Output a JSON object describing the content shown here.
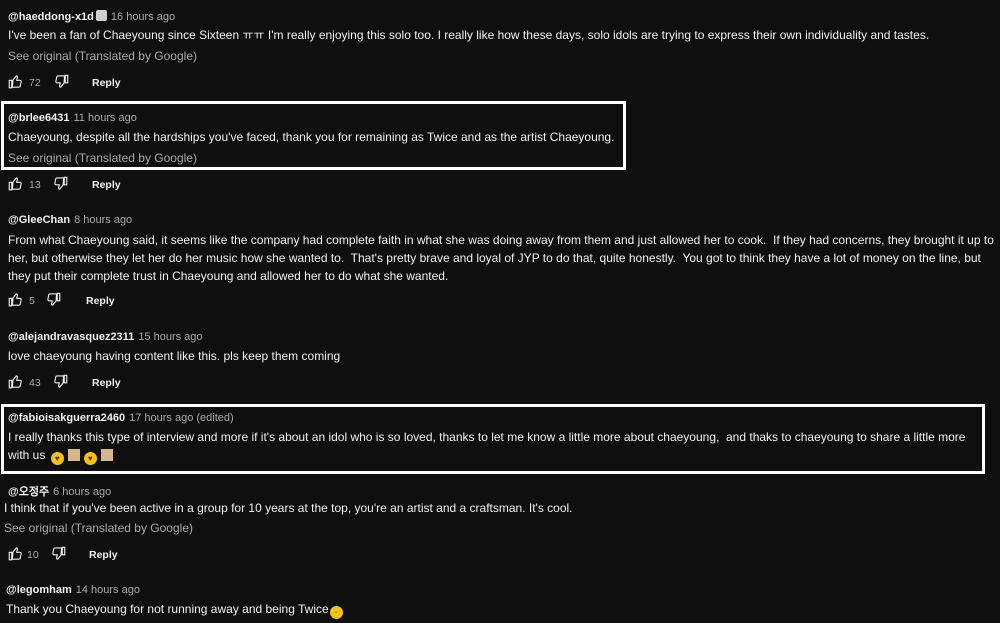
{
  "reply_label": "Reply",
  "see_original_label": "See original (Translated by Google)",
  "comments": [
    {
      "author": "@haeddong-x1d",
      "time": "16 hours ago",
      "text": "I've been a fan of Chaeyoung since Sixteen ㅠㅠ I'm really enjoying this solo too. I really like how these days, solo idols are trying to express their own individuality and tastes.",
      "likes": "72"
    },
    {
      "author": "@brlee6431",
      "time": "11 hours ago",
      "text": "Chaeyoung, despite all the hardships you've faced, thank you for remaining as Twice and as the artist Chaeyoung.",
      "likes": "13"
    },
    {
      "author": "@GleeChan",
      "time": "8 hours ago",
      "text": "From what Chaeyoung said, it seems like the company had complete faith in what she was doing away from them and just allowed her to cook.  If they had concerns, they brought it up to her, but otherwise they let her do her music how she wanted to.  That's pretty brave and loyal of JYP to do that, quite honestly.  You got to think they have a lot of money on the line, but they put their complete trust in Chaeyoung and allowed her to do what she wanted.",
      "likes": "5"
    },
    {
      "author": "@alejandravasquez2311",
      "time": "15 hours ago",
      "text": "love chaeyoung having content like this. pls keep them coming",
      "likes": "43"
    },
    {
      "author": "@fabioisakguerra2460",
      "time": "17 hours ago (edited)",
      "text": "I really thanks this type of interview and more if it's about an idol who is so loved, thanks to let me know a little more about chaeyoung,  and thaks to chaeyoung to share a little more with us",
      "likes": ""
    },
    {
      "author": "@오정주",
      "time": "6 hours ago",
      "text": "I think that if you've been active in a group for 10 years at the top, you're an artist and a craftsman. It's cool.",
      "likes": "10"
    },
    {
      "author": "@legomham",
      "time": "14 hours ago",
      "text": "Thank you Chaeyoung for not running away and being Twice",
      "likes": ""
    }
  ]
}
